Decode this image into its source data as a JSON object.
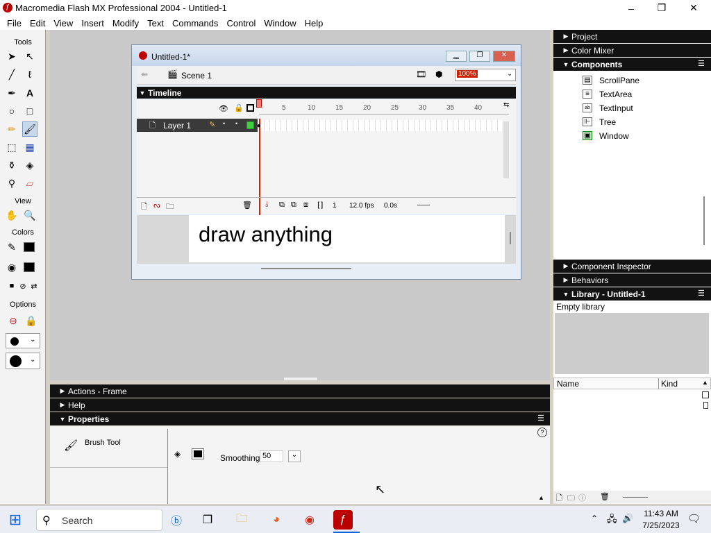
{
  "window": {
    "title": "Macromedia Flash MX Professional 2004 - Untitled-1"
  },
  "menu": [
    "File",
    "Edit",
    "View",
    "Insert",
    "Modify",
    "Text",
    "Commands",
    "Control",
    "Window",
    "Help"
  ],
  "tools": {
    "title": "Tools",
    "view": "View",
    "colors": "Colors",
    "options": "Options"
  },
  "doc": {
    "title": "Untitled-1*",
    "scene": "Scene 1",
    "zoom": "100%",
    "timeline": "Timeline",
    "layer": "Layer 1",
    "ruler": [
      "5",
      "10",
      "15",
      "20",
      "25",
      "30",
      "35",
      "40"
    ],
    "frame": "1",
    "fps": "12.0 fps",
    "time": "0.0s",
    "stage_text": "draw anything"
  },
  "right": {
    "project": "Project",
    "color_mixer": "Color Mixer",
    "components": "Components",
    "items": [
      "ScrollPane",
      "TextArea",
      "TextInput",
      "Tree",
      "Window"
    ],
    "inspector": "Component Inspector",
    "behaviors": "Behaviors",
    "library": "Library - Untitled-1",
    "library_empty": "Empty library",
    "col_name": "Name",
    "col_kind": "Kind"
  },
  "bottom": {
    "actions": "Actions - Frame",
    "help": "Help",
    "properties": "Properties",
    "tool_name": "Brush Tool",
    "smoothing_label": "Smoothing",
    "smoothing_value": "50"
  },
  "taskbar": {
    "search": "Search",
    "time": "11:43 AM",
    "date": "7/25/2023"
  },
  "colors": {
    "accent": "#cc2200",
    "panel": "#121212"
  }
}
